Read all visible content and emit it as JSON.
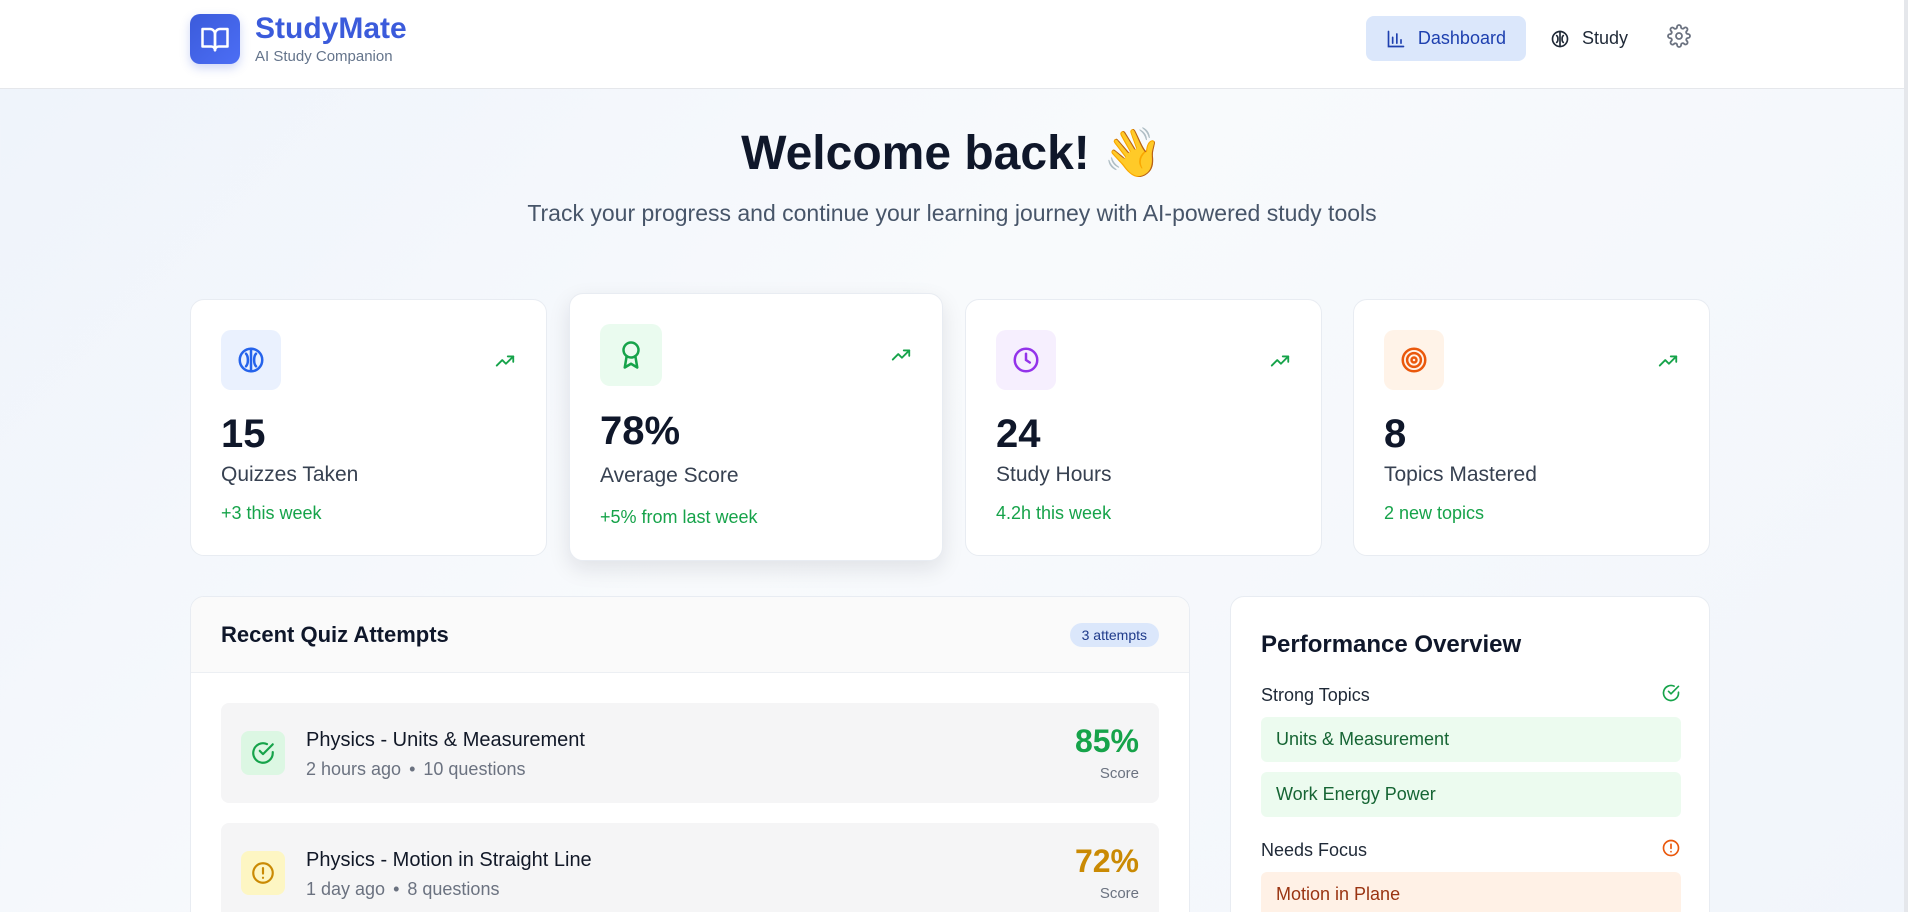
{
  "brand": {
    "name": "StudyMate",
    "tagline": "AI Study Companion"
  },
  "nav": {
    "dashboard_label": "Dashboard",
    "study_label": "Study",
    "active": "Dashboard"
  },
  "hero": {
    "title": "Welcome back! 👋",
    "subtitle": "Track your progress and continue your learning journey with AI-powered study tools"
  },
  "stats": [
    {
      "value": "15",
      "label": "Quizzes Taken",
      "delta": "+3 this week",
      "icon": "brain-icon",
      "color": "#2563eb"
    },
    {
      "value": "78%",
      "label": "Average Score",
      "delta": "+5% from last week",
      "icon": "award-icon",
      "color": "#16a34a"
    },
    {
      "value": "24",
      "label": "Study Hours",
      "delta": "4.2h this week",
      "icon": "clock-icon",
      "color": "#9333ea"
    },
    {
      "value": "8",
      "label": "Topics Mastered",
      "delta": "2 new topics",
      "icon": "target-icon",
      "color": "#ea580c"
    }
  ],
  "recent": {
    "title": "Recent Quiz Attempts",
    "badge": "3 attempts",
    "items": [
      {
        "title": "Physics - Units & Measurement",
        "time": "2 hours ago",
        "questions": "10 questions",
        "score": "85%",
        "score_label": "Score",
        "status": "check-circle-icon",
        "color": "#16a34a"
      },
      {
        "title": "Physics - Motion in Straight Line",
        "time": "1 day ago",
        "questions": "8 questions",
        "score": "72%",
        "score_label": "Score",
        "status": "alert-circle-icon",
        "color": "#ca8a04"
      }
    ]
  },
  "performance": {
    "title": "Performance Overview",
    "strong_label": "Strong Topics",
    "strong": [
      "Units & Measurement",
      "Work Energy Power"
    ],
    "focus_label": "Needs Focus",
    "focus": [
      "Motion in Plane"
    ]
  }
}
